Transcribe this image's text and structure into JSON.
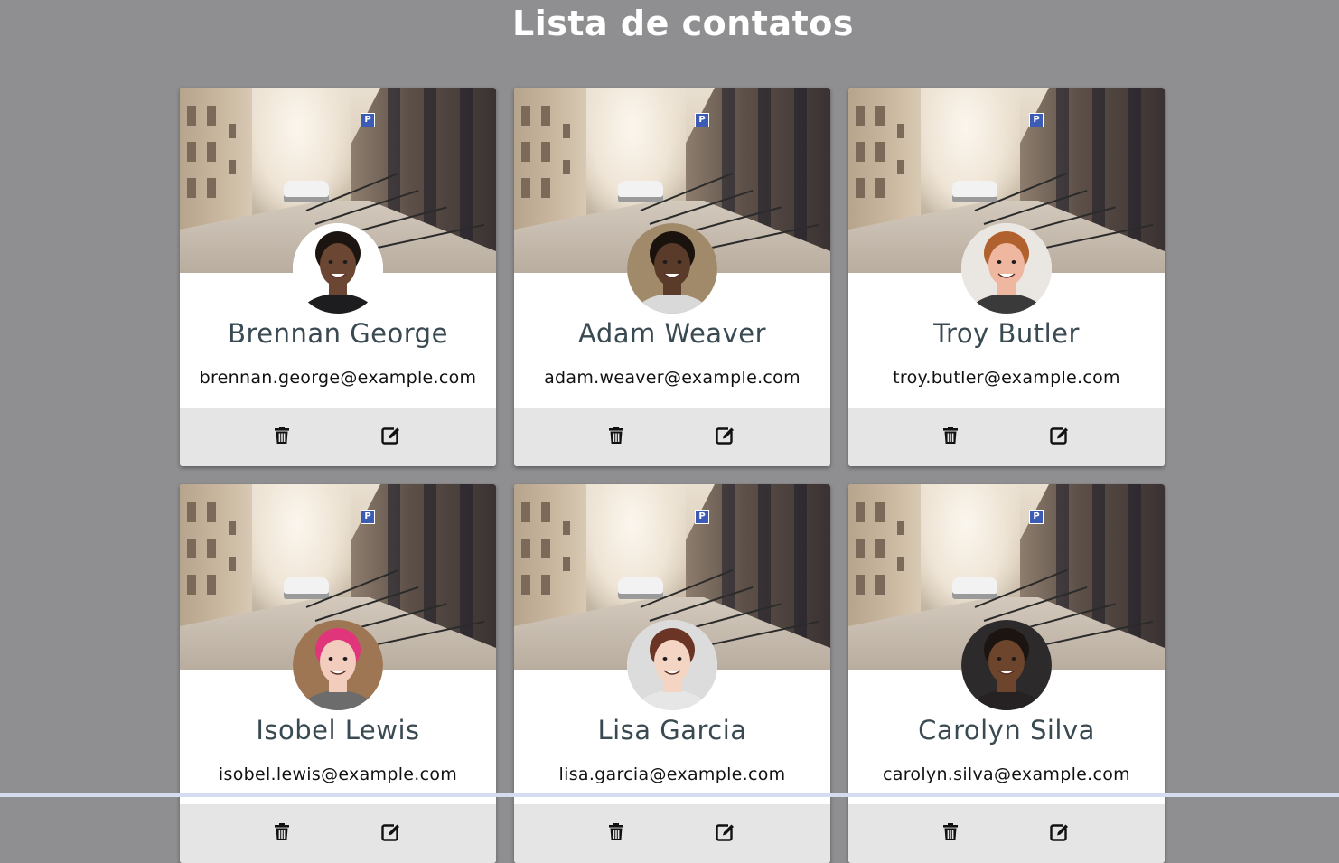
{
  "page": {
    "title": "Lista de contatos"
  },
  "colors": {
    "background": "#8f8f91",
    "card": "#ffffff",
    "actions_bar": "#e5e5e5",
    "name_text": "#3a4a52",
    "email_text": "#111111"
  },
  "icons": {
    "delete": "trash-icon",
    "edit": "edit-icon"
  },
  "contacts": [
    {
      "name": "Brennan George",
      "email": "brennan.george@example.com",
      "avatar": "avatar-photo",
      "skin": "#6b4632",
      "hair": "#1c1410",
      "shirt": "#1d1d1f",
      "bg": "#ffffff"
    },
    {
      "name": "Adam Weaver",
      "email": "adam.weaver@example.com",
      "avatar": "avatar-photo",
      "skin": "#5a3a28",
      "hair": "#1a120c",
      "shirt": "#d9d9d9",
      "bg": "#a08a6a"
    },
    {
      "name": "Troy Butler",
      "email": "troy.butler@example.com",
      "avatar": "avatar-photo",
      "skin": "#f0b7a0",
      "hair": "#b0612e",
      "shirt": "#3a3a3a",
      "bg": "#eae6e2"
    },
    {
      "name": "Isobel Lewis",
      "email": "isobel.lewis@example.com",
      "avatar": "avatar-photo",
      "skin": "#f2cdbd",
      "hair": "#e0357a",
      "shirt": "#6c6c6c",
      "bg": "#9e7654"
    },
    {
      "name": "Lisa Garcia",
      "email": "lisa.garcia@example.com",
      "avatar": "avatar-photo",
      "skin": "#f4d5c4",
      "hair": "#6a3525",
      "shirt": "#e6e6e6",
      "bg": "#dcdcdc"
    },
    {
      "name": "Carolyn Silva",
      "email": "carolyn.silva@example.com",
      "avatar": "avatar-photo",
      "skin": "#6d452d",
      "hair": "#1b1411",
      "shirt": "#262122",
      "bg": "#2d2a2b"
    }
  ]
}
